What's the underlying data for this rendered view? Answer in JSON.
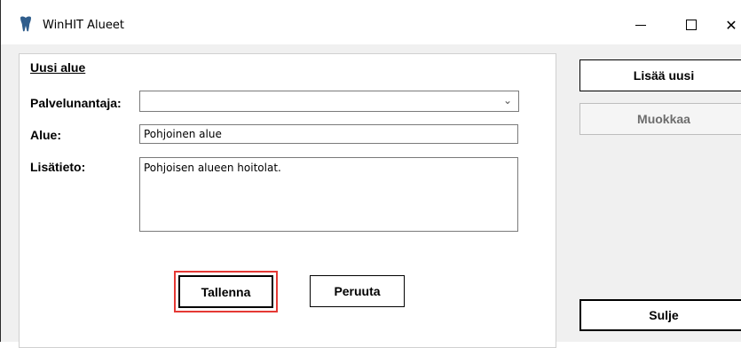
{
  "window": {
    "title": "WinHIT Alueet",
    "icon": "tooth-icon",
    "controls": {
      "minimize": "minimize",
      "maximize": "maximize",
      "close": "close"
    }
  },
  "form": {
    "section_title": "Uusi alue",
    "provider_label": "Palvelunantaja:",
    "provider_value": "",
    "area_label": "Alue:",
    "area_value": "Pohjoinen alue",
    "info_label": "Lisätieto:",
    "info_value": "Pohjoisen alueen hoitolat.",
    "save_label": "Tallenna",
    "cancel_label": "Peruuta"
  },
  "sidebar": {
    "add_label": "Lisää uusi",
    "edit_label": "Muokkaa",
    "close_label": "Sulje"
  },
  "colors": {
    "highlight": "#e53935",
    "disabled_text": "#6d6d6d",
    "icon_color": "#2f5d8c"
  }
}
